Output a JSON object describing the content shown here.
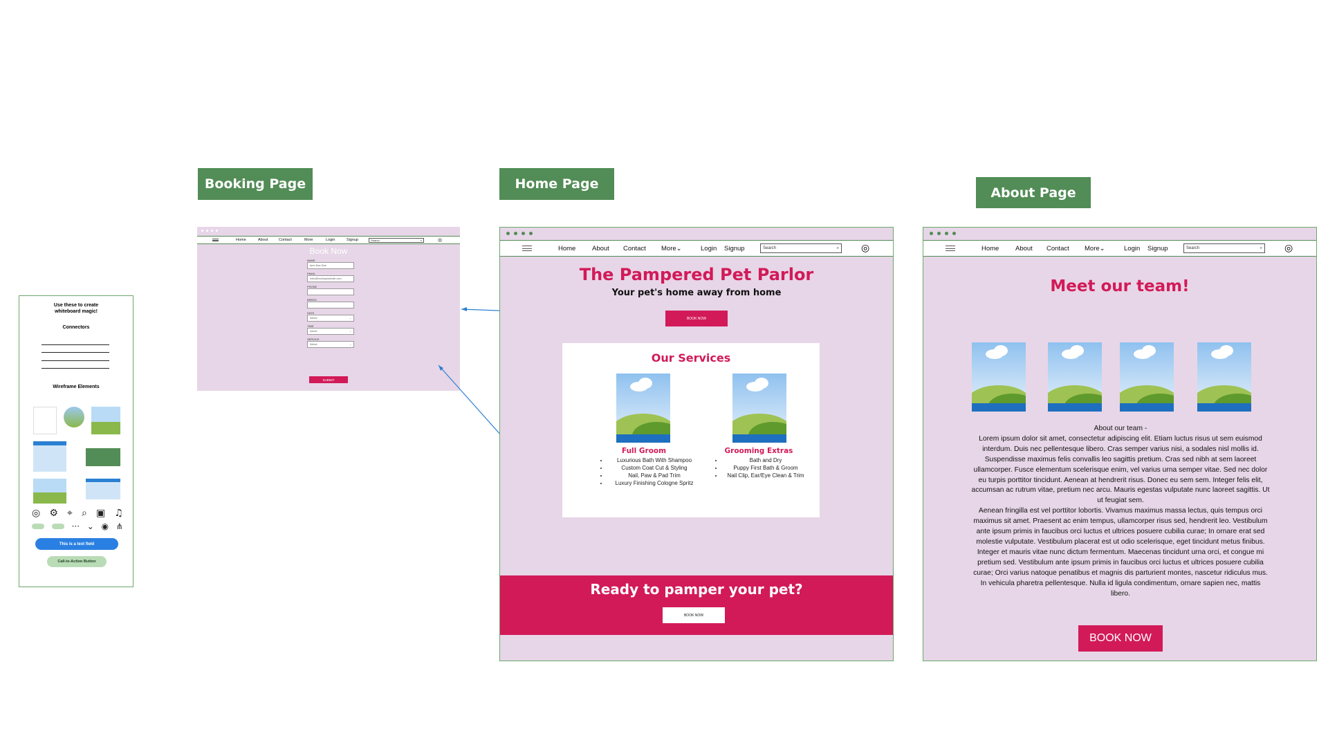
{
  "labels": {
    "booking": "Booking Page",
    "home": "Home Page",
    "about": "About Page"
  },
  "nav": {
    "home": "Home",
    "about": "About",
    "contact": "Contact",
    "more": "More",
    "login": "Login",
    "signup": "Signup",
    "search_placeholder": "Search"
  },
  "booking": {
    "title": "Book Now",
    "fields": {
      "name_label": "NAME",
      "name_value": "Jane Doe Doe",
      "email_label": "EMAIL",
      "email_value": "hello@reallygreatsite.com",
      "phone_label": "PHONE",
      "breed_label": "BREED",
      "date_label": "DATE",
      "date_value": "Select",
      "time_label": "TIME",
      "time_value": "Select",
      "service_label": "SERVICE",
      "service_value": "Select"
    },
    "submit": "SUBMIT"
  },
  "home": {
    "title": "The Pampered Pet Parlor",
    "subtitle": "Your pet's home away from home",
    "book_button": "BOOK NOW",
    "services_title": "Our Services",
    "services": [
      {
        "name": "Full Groom",
        "items": [
          "Luxurious Bath With Shampoo",
          "Custom Coat Cut & Styling",
          "Nail, Paw & Pad Trim",
          "Luxury Finishing Cologne Spritz"
        ]
      },
      {
        "name": "Grooming Extras",
        "items": [
          "Bath and Dry",
          "Puppy First Bath & Groom",
          "Nail Clip, Ear/Eye Clean & Trim"
        ]
      }
    ],
    "cta_title": "Ready to pamper your pet?",
    "cta_button": "BOOK NOW"
  },
  "about": {
    "title": "Meet our team!",
    "about_heading": "About our team -",
    "para1": "Lorem ipsum dolor sit amet, consectetur adipiscing elit. Etiam luctus risus ut sem euismod interdum. Duis nec pellentesque libero. Cras semper varius nisi, a sodales nisl mollis id. Suspendisse maximus felis convallis leo sagittis pretium. Cras sed nibh at sem laoreet ullamcorper. Fusce elementum scelerisque enim, vel varius urna semper vitae. Sed nec dolor eu turpis porttitor tincidunt. Aenean at hendrerit risus. Donec eu sem sem. Integer felis elit, accumsan ac rutrum vitae, pretium nec arcu. Mauris egestas vulputate nunc laoreet sagittis. Ut ut feugiat sem.",
    "para2": "Aenean fringilla est vel porttitor lobortis. Vivamus maximus massa lectus, quis tempus orci maximus sit amet. Praesent ac enim tempus, ullamcorper risus sed, hendrerit leo. Vestibulum ante ipsum primis in faucibus orci luctus et ultrices posuere cubilia curae; In ornare erat sed molestie vulputate. Vestibulum placerat est ut odio scelerisque, eget tincidunt metus finibus. Integer et mauris vitae nunc dictum fermentum. Maecenas tincidunt urna orci, et congue mi pretium sed. Vestibulum ante ipsum primis in faucibus orci luctus et ultrices posuere cubilia curae; Orci varius natoque penatibus et magnis dis parturient montes, nascetur ridiculus mus. In vehicula pharetra pellentesque. Nulla id ligula condimentum, ornare sapien nec, mattis libero.",
    "book_button": "BOOK NOW"
  },
  "kit": {
    "intro": "Use these to create whiteboard magic!",
    "connectors": "Connectors",
    "wireframe": "Wireframe Elements",
    "text_field": "This is a text field",
    "cta": "Call-to-Action Button"
  },
  "colors": {
    "accent": "#d21a58",
    "frame_bg": "#e7d6e7",
    "label_green": "#528c56"
  }
}
